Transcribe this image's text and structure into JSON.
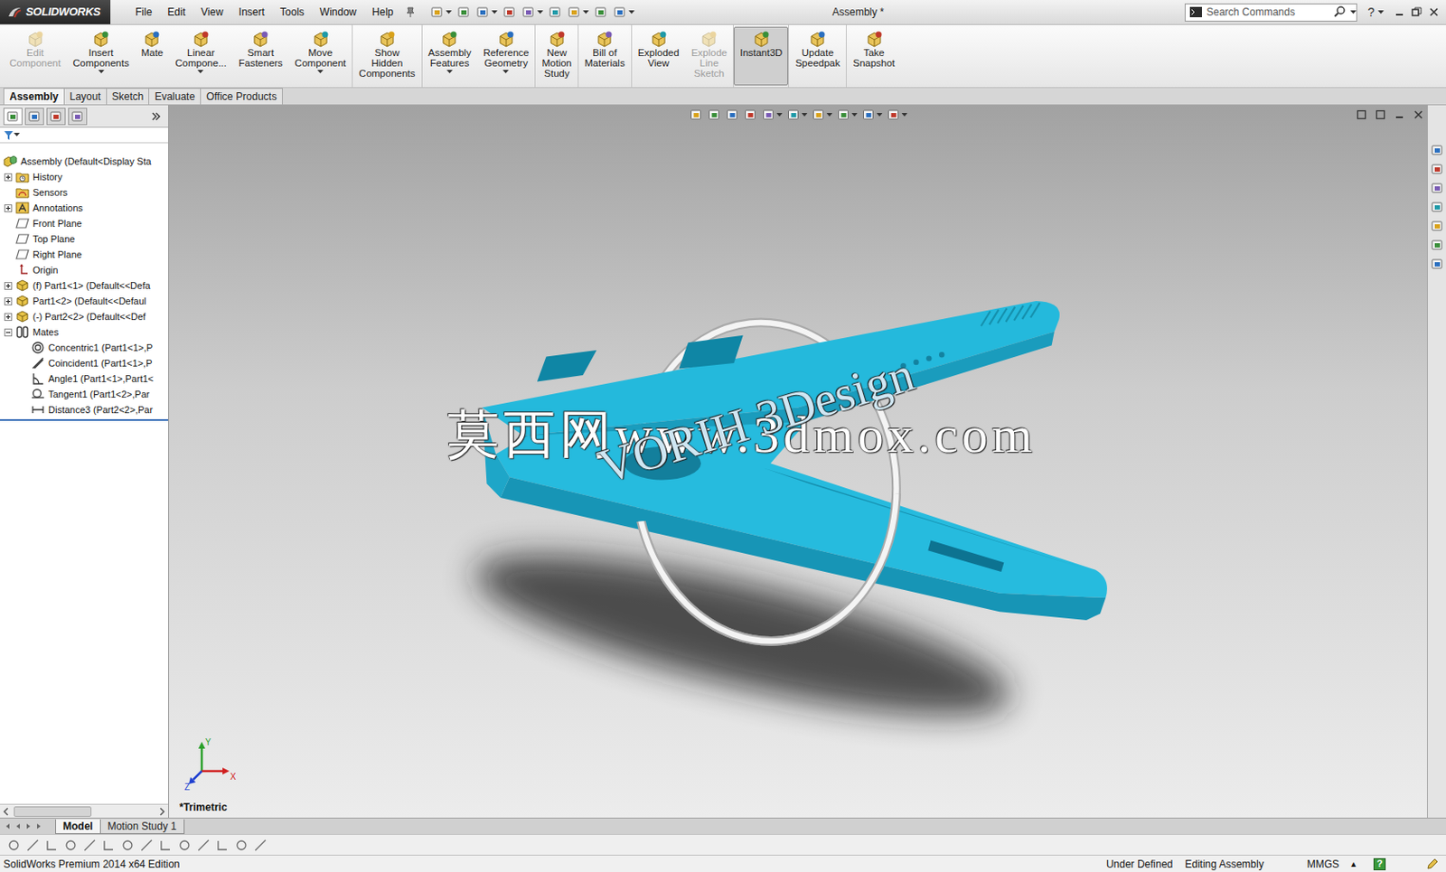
{
  "app": {
    "logo": "SOLIDWORKS",
    "title": "Assembly *",
    "help": "?"
  },
  "menu": [
    "File",
    "Edit",
    "View",
    "Insert",
    "Tools",
    "Window",
    "Help"
  ],
  "search": {
    "placeholder": "Search Commands"
  },
  "toolbar": [
    [
      {
        "lines": [
          "Edit",
          "Component"
        ],
        "disabled": true,
        "selected": false,
        "dropdown": false
      },
      {
        "lines": [
          "Insert",
          "Components"
        ],
        "disabled": false,
        "selected": false,
        "dropdown": true
      },
      {
        "lines": [
          "Mate"
        ],
        "disabled": false,
        "selected": false,
        "dropdown": false
      },
      {
        "lines": [
          "Linear",
          "Compone..."
        ],
        "disabled": false,
        "selected": false,
        "dropdown": true
      },
      {
        "lines": [
          "Smart",
          "Fasteners"
        ],
        "disabled": false,
        "selected": false,
        "dropdown": false
      },
      {
        "lines": [
          "Move",
          "Component"
        ],
        "disabled": false,
        "selected": false,
        "dropdown": true
      }
    ],
    [
      {
        "lines": [
          "Show",
          "Hidden",
          "Components"
        ],
        "disabled": false,
        "selected": false,
        "dropdown": false
      }
    ],
    [
      {
        "lines": [
          "Assembly",
          "Features"
        ],
        "disabled": false,
        "selected": false,
        "dropdown": true
      },
      {
        "lines": [
          "Reference",
          "Geometry"
        ],
        "disabled": false,
        "selected": false,
        "dropdown": true
      }
    ],
    [
      {
        "lines": [
          "New",
          "Motion",
          "Study"
        ],
        "disabled": false,
        "selected": false,
        "dropdown": false
      }
    ],
    [
      {
        "lines": [
          "Bill of",
          "Materials"
        ],
        "disabled": false,
        "selected": false,
        "dropdown": false
      }
    ],
    [
      {
        "lines": [
          "Exploded",
          "View"
        ],
        "disabled": false,
        "selected": false,
        "dropdown": false
      },
      {
        "lines": [
          "Explode",
          "Line",
          "Sketch"
        ],
        "disabled": true,
        "selected": false,
        "dropdown": false
      }
    ],
    [
      {
        "lines": [
          "Instant3D"
        ],
        "disabled": false,
        "selected": true,
        "dropdown": false
      }
    ],
    [
      {
        "lines": [
          "Update",
          "Speedpak"
        ],
        "disabled": false,
        "selected": false,
        "dropdown": false
      }
    ],
    [
      {
        "lines": [
          "Take",
          "Snapshot"
        ],
        "disabled": false,
        "selected": false,
        "dropdown": false
      }
    ]
  ],
  "tabs": [
    {
      "label": "Assembly",
      "selected": true
    },
    {
      "label": "Layout",
      "selected": false
    },
    {
      "label": "Sketch",
      "selected": false
    },
    {
      "label": "Evaluate",
      "selected": false
    },
    {
      "label": "Office Products",
      "selected": false
    }
  ],
  "feature_tree": {
    "items": [
      {
        "label": "Assembly  (Default<Display Sta",
        "kind": "assembly",
        "level": 0,
        "expandable": false,
        "expanded": false
      },
      {
        "label": "History",
        "kind": "history",
        "level": 1,
        "expandable": true,
        "expanded": false
      },
      {
        "label": "Sensors",
        "kind": "sensor",
        "level": 1,
        "expandable": false,
        "expanded": false
      },
      {
        "label": "Annotations",
        "kind": "annotation",
        "level": 1,
        "expandable": true,
        "expanded": false
      },
      {
        "label": "Front Plane",
        "kind": "plane",
        "level": 1,
        "expandable": false,
        "expanded": false
      },
      {
        "label": "Top Plane",
        "kind": "plane",
        "level": 1,
        "expandable": false,
        "expanded": false
      },
      {
        "label": "Right Plane",
        "kind": "plane",
        "level": 1,
        "expandable": false,
        "expanded": false
      },
      {
        "label": "Origin",
        "kind": "origin",
        "level": 1,
        "expandable": false,
        "expanded": false
      },
      {
        "label": "(f) Part1<1> (Default<<Defa",
        "kind": "part",
        "level": 1,
        "expandable": true,
        "expanded": false
      },
      {
        "label": "Part1<2> (Default<<Defaul",
        "kind": "part",
        "level": 1,
        "expandable": true,
        "expanded": false
      },
      {
        "label": "(-) Part2<2> (Default<<Def",
        "kind": "part",
        "level": 1,
        "expandable": true,
        "expanded": false
      },
      {
        "label": "Mates",
        "kind": "mates",
        "level": 1,
        "expandable": true,
        "expanded": true
      },
      {
        "label": "Concentric1 (Part1<1>,P",
        "kind": "concentric",
        "level": 2,
        "expandable": false,
        "expanded": false
      },
      {
        "label": "Coincident1 (Part1<1>,P",
        "kind": "coincident",
        "level": 2,
        "expandable": false,
        "expanded": false
      },
      {
        "label": "Angle1 (Part1<1>,Part1<",
        "kind": "angle",
        "level": 2,
        "expandable": false,
        "expanded": false
      },
      {
        "label": "Tangent1 (Part1<2>,Par",
        "kind": "tangent",
        "level": 2,
        "expandable": false,
        "expanded": false
      },
      {
        "label": "Distance3 (Part2<2>,Par",
        "kind": "distance",
        "level": 2,
        "expandable": false,
        "expanded": false
      }
    ]
  },
  "viewport": {
    "view_name": "*Trimetric",
    "watermark_cn": "莫西网www.3dmox.com",
    "watermark_en": "VORIH 3Design",
    "axes": [
      {
        "label": "Y",
        "color": "#2aa02a"
      },
      {
        "label": "X",
        "color": "#d02020"
      },
      {
        "label": "Z",
        "color": "#2040d0"
      }
    ]
  },
  "bottom_tabs": [
    {
      "label": "Model",
      "selected": true
    },
    {
      "label": "Motion Study 1",
      "selected": false
    }
  ],
  "status_bar": {
    "product": "SolidWorks Premium 2014 x64 Edition",
    "state": "Under Defined",
    "mode": "Editing Assembly",
    "units": "MMGS",
    "units_arrow": "▴",
    "help": "?"
  }
}
